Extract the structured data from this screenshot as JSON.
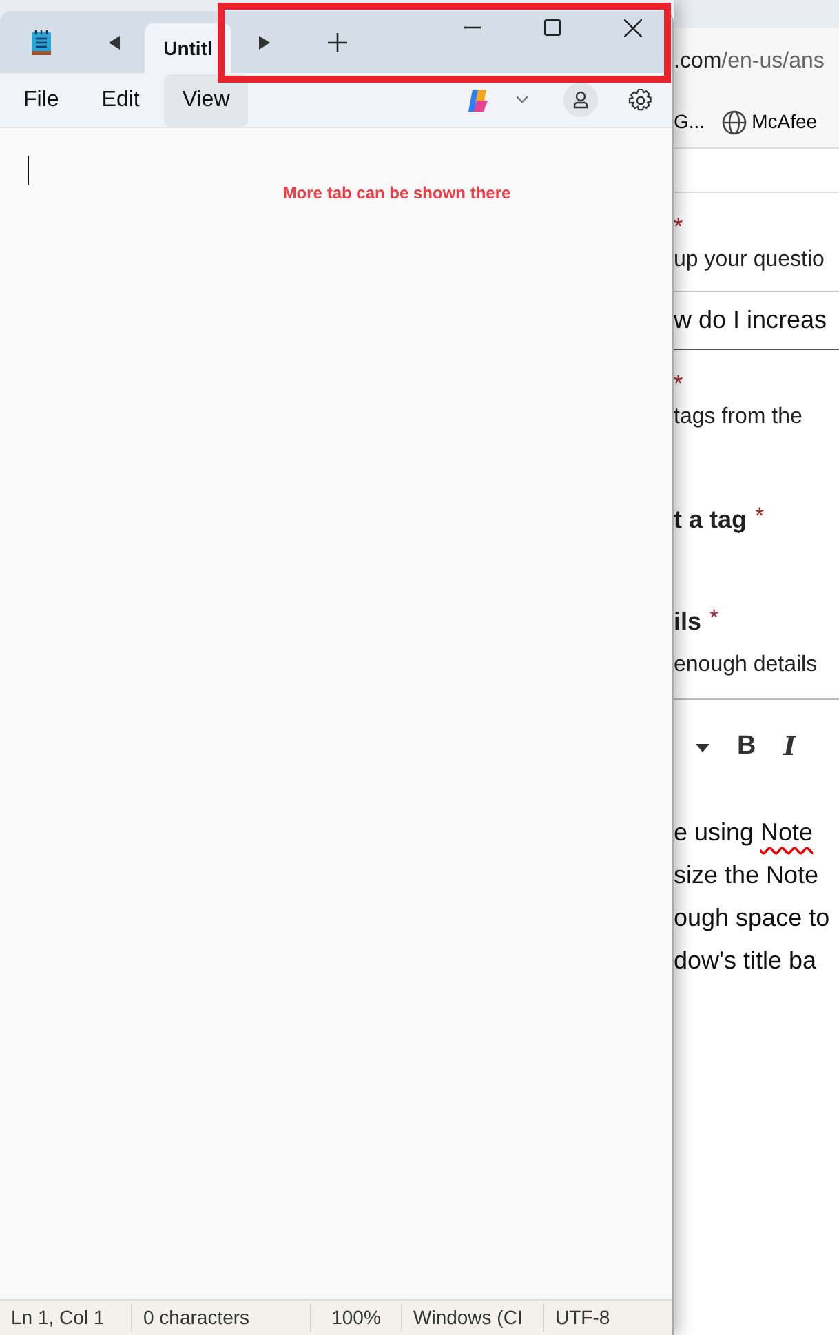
{
  "notepad": {
    "tabs": [
      {
        "label": "Untitl",
        "selected": true
      }
    ],
    "menu": [
      {
        "label": "File",
        "hovered": false
      },
      {
        "label": "Edit",
        "hovered": false
      },
      {
        "label": "View",
        "hovered": true
      }
    ],
    "annotation": "More tab can be shown there",
    "status_bar": [
      "Ln 1, Col 1",
      "0 characters",
      "100%",
      "Windows (CI",
      "UTF-8"
    ]
  },
  "browser": {
    "address_host": ".com",
    "address_path": "/en-us/ans",
    "bookmarks": [
      "G...",
      "McAfee"
    ],
    "form": [
      {
        "kind": "star",
        "text": "*"
      },
      {
        "kind": "hint",
        "text": "up your questio"
      },
      {
        "kind": "input",
        "value": "w do I increas"
      },
      {
        "kind": "star",
        "text": "*"
      },
      {
        "kind": "hint",
        "text": "tags from the"
      },
      {
        "kind": "heading",
        "text": "t a tag",
        "star": "*"
      },
      {
        "kind": "heading",
        "text": "ils",
        "star": "*"
      },
      {
        "kind": "hint",
        "text": "enough details"
      },
      {
        "kind": "toolbar",
        "buttons": [
          "B",
          "I"
        ]
      },
      {
        "kind": "editor",
        "lines": [
          {
            "text": "e using ",
            "flagged": "Note"
          },
          {
            "text": "size the Note"
          },
          {
            "text": "ough space to"
          },
          {
            "text": "dow's title ba"
          }
        ]
      }
    ]
  }
}
